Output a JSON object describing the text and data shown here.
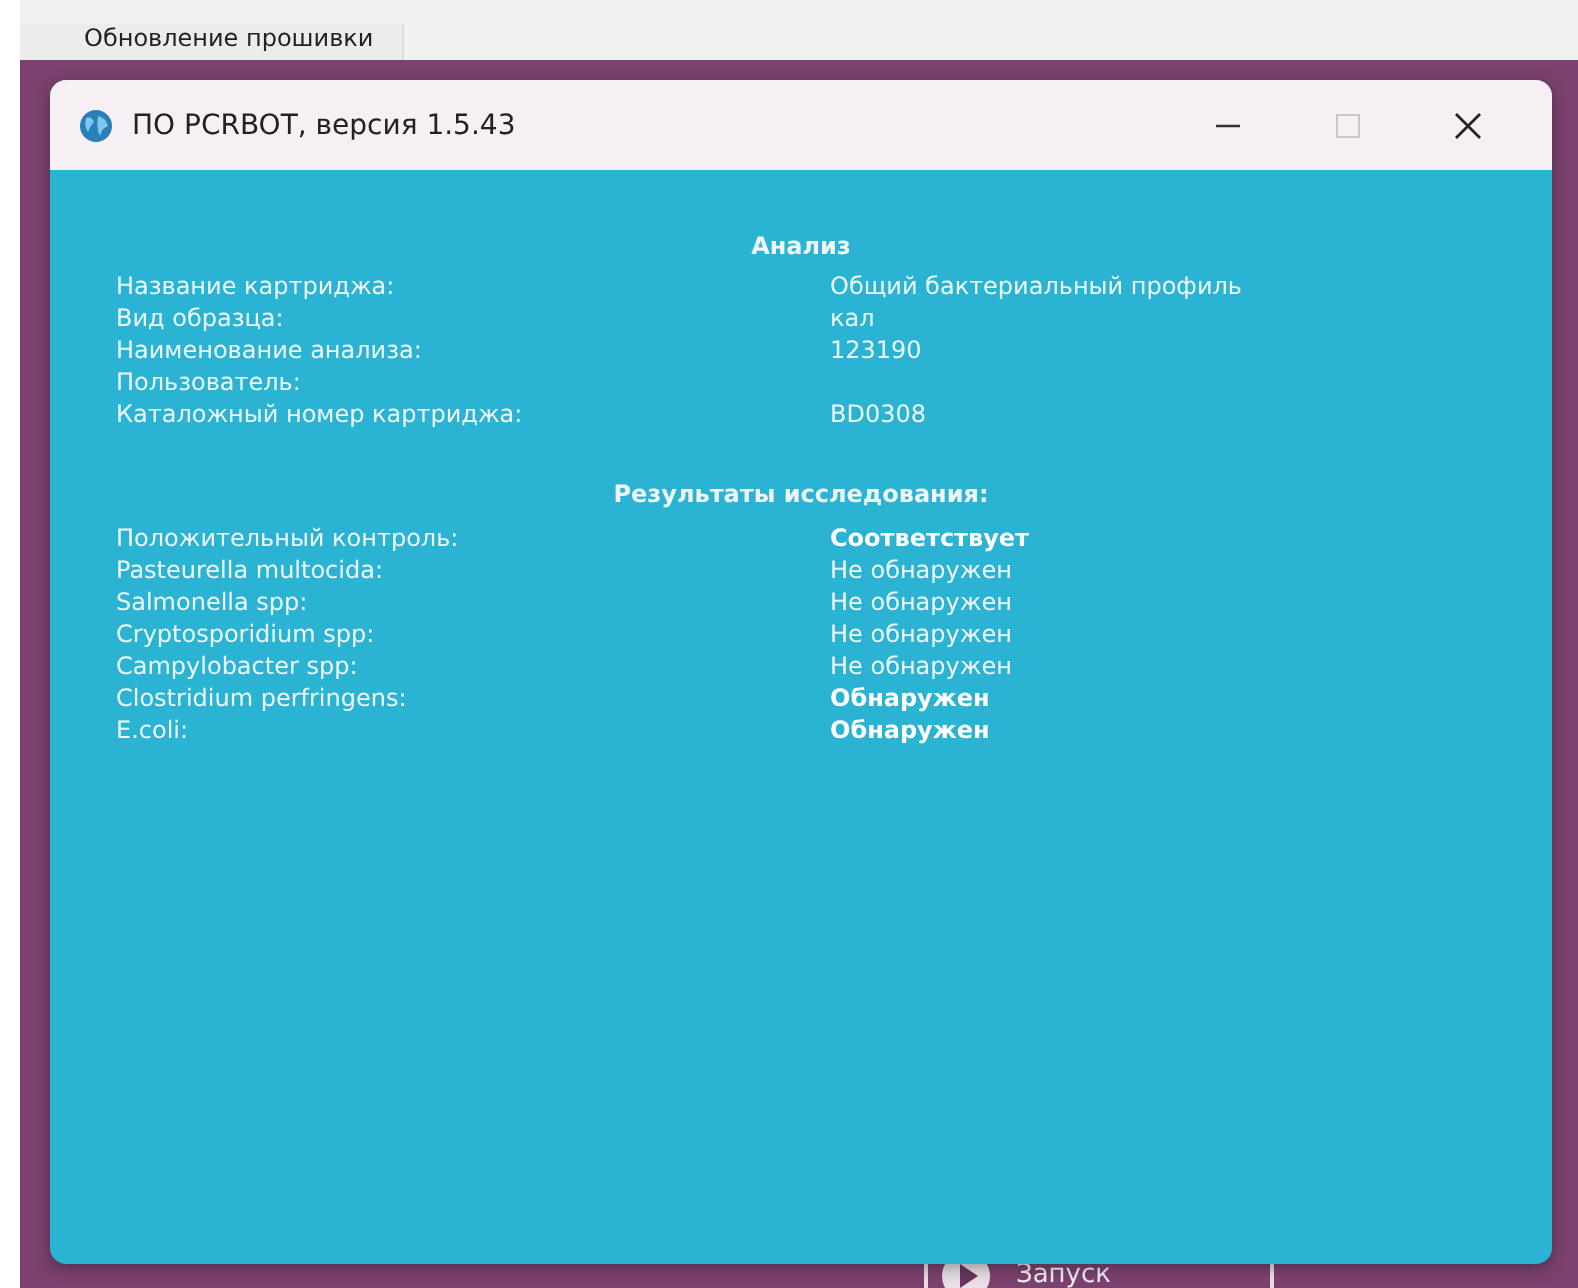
{
  "background_app": {
    "tab": "Обновление прошивки",
    "button": "Запуск"
  },
  "window": {
    "title": "ПО PCRBOT, версия 1.5.43",
    "maximize_disabled": true
  },
  "analysis": {
    "heading": "Анализ",
    "rows": [
      {
        "label": "Название картриджа:",
        "value": "Общий бактериальный профиль"
      },
      {
        "label": "Вид образца:",
        "value": "кал"
      },
      {
        "label": "Наименование анализа:",
        "value": "123190"
      },
      {
        "label": "Пользователь:"
      },
      {
        "label": "Каталожный номер картриджа:",
        "value": "BD0308"
      }
    ]
  },
  "results": {
    "heading": "Результаты исследования:",
    "rows": [
      {
        "label": "Положительный контроль:",
        "value": "Соответствует",
        "bold": true
      },
      {
        "label": "Pasteurella multocida:",
        "value": "Не обнаружен",
        "bold": false
      },
      {
        "label": "Salmonella spp:",
        "value": "Не обнаружен",
        "bold": false
      },
      {
        "label": "Cryptosporidium spp:",
        "value": "Не обнаружен",
        "bold": false
      },
      {
        "label": "Campylobacter spp:",
        "value": "Не обнаружен",
        "bold": false
      },
      {
        "label": "Clostridium perfringens:",
        "value": "Обнаружен",
        "bold": true
      },
      {
        "label": "E.coli:",
        "value": "Обнаружен",
        "bold": true
      }
    ]
  }
}
